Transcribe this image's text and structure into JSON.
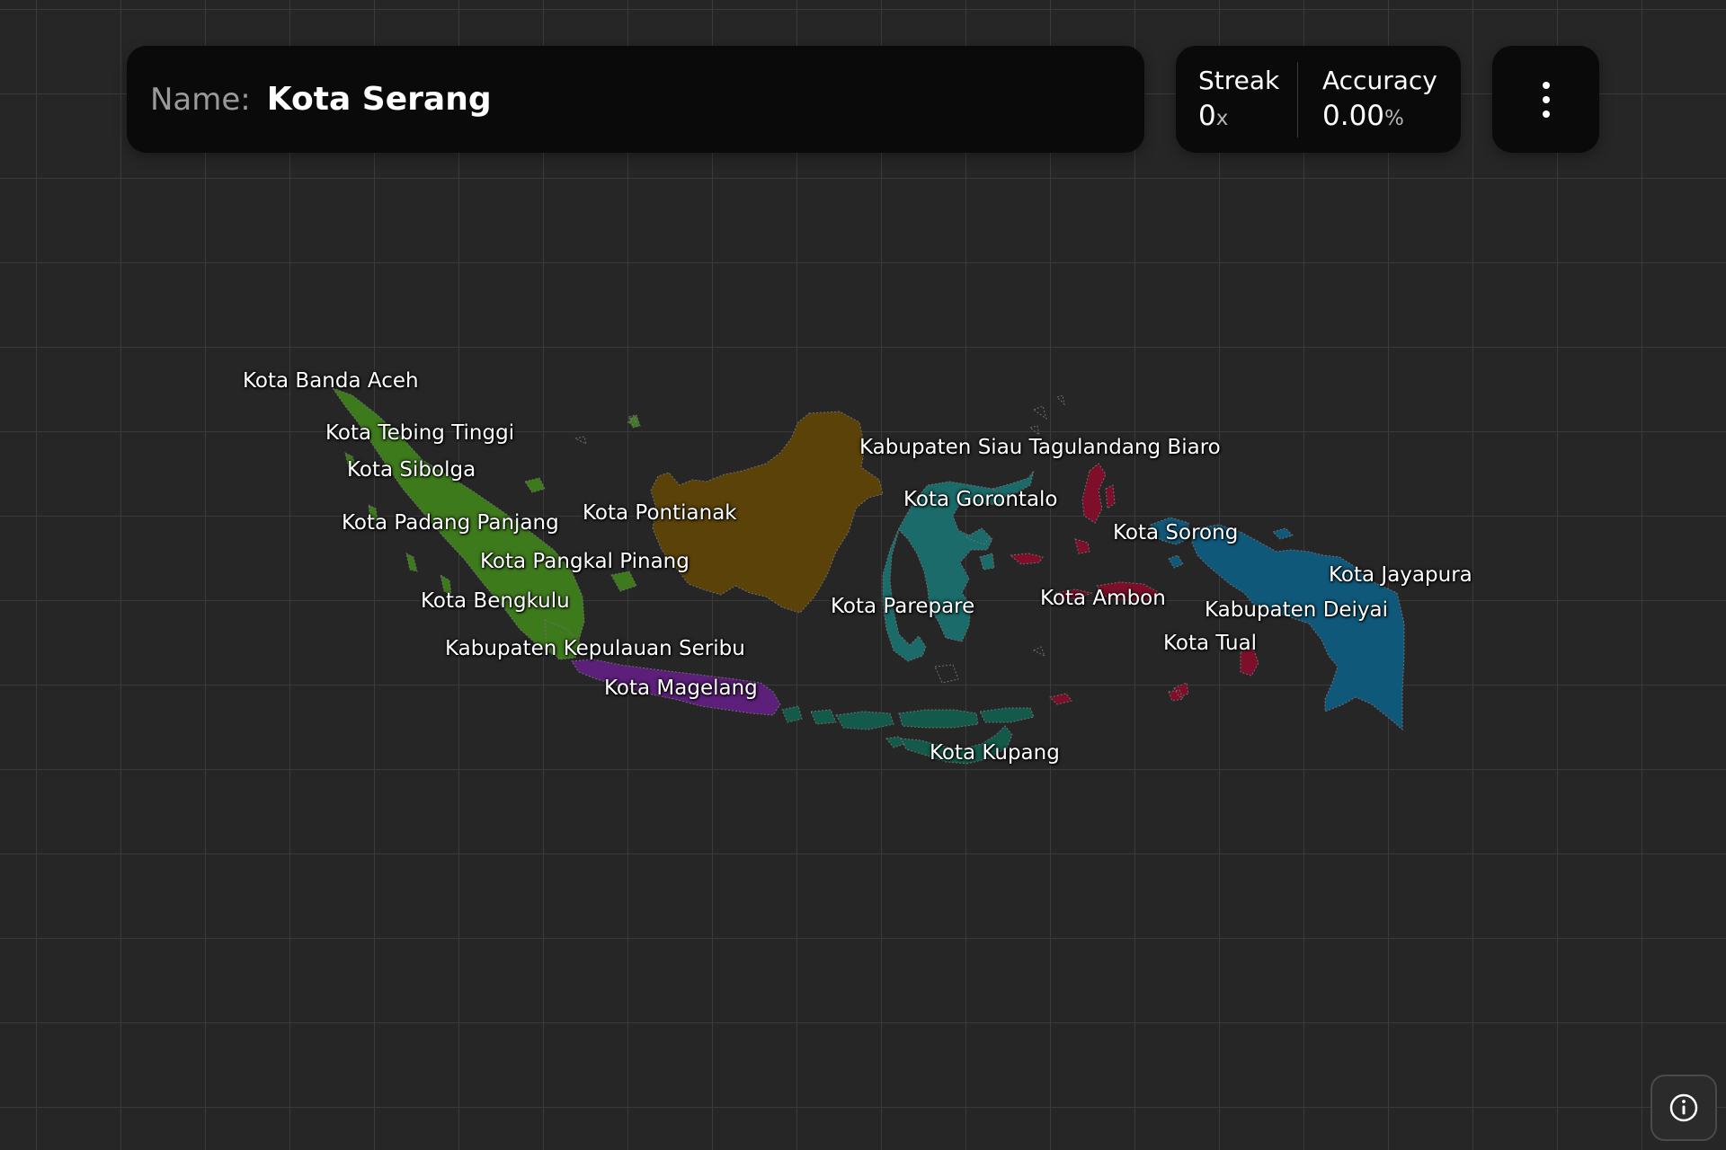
{
  "header": {
    "name_label": "Name:",
    "name_value": "Kota Serang"
  },
  "stats": {
    "streak_label": "Streak",
    "streak_value": "0",
    "streak_suffix": "x",
    "accuracy_label": "Accuracy",
    "accuracy_value": "0.00",
    "accuracy_suffix": "%"
  },
  "menu": {
    "icon": "vertical-dots-icon"
  },
  "info": {
    "icon": "info-icon"
  },
  "colors": {
    "background": "#262626",
    "grid": "#3a3a3a",
    "panel": "#0a0a0a",
    "sumatra": "#3d7a1c",
    "kalimantan": "#5a4209",
    "sulawesi": "#1a6b6a",
    "java": "#5c1f7a",
    "nusa_tenggara": "#135a4a",
    "maluku": "#7d0f2a",
    "papua": "#10587a"
  },
  "map_labels": [
    "Kota Banda Aceh",
    "Kota Tebing Tinggi",
    "Kota Sibolga",
    "Kota Padang Panjang",
    "Kota Pontianak",
    "Kota Pangkal Pinang",
    "Kota Bengkulu",
    "Kabupaten Kepulauan Seribu",
    "Kota Magelang",
    "Kabupaten Siau Tagulandang Biaro",
    "Kota Gorontalo",
    "Kota Parepare",
    "Kota Ambon",
    "Kota Sorong",
    "Kota Jayapura",
    "Kabupaten Deiyai",
    "Kota Tual",
    "Kota Kupang"
  ]
}
